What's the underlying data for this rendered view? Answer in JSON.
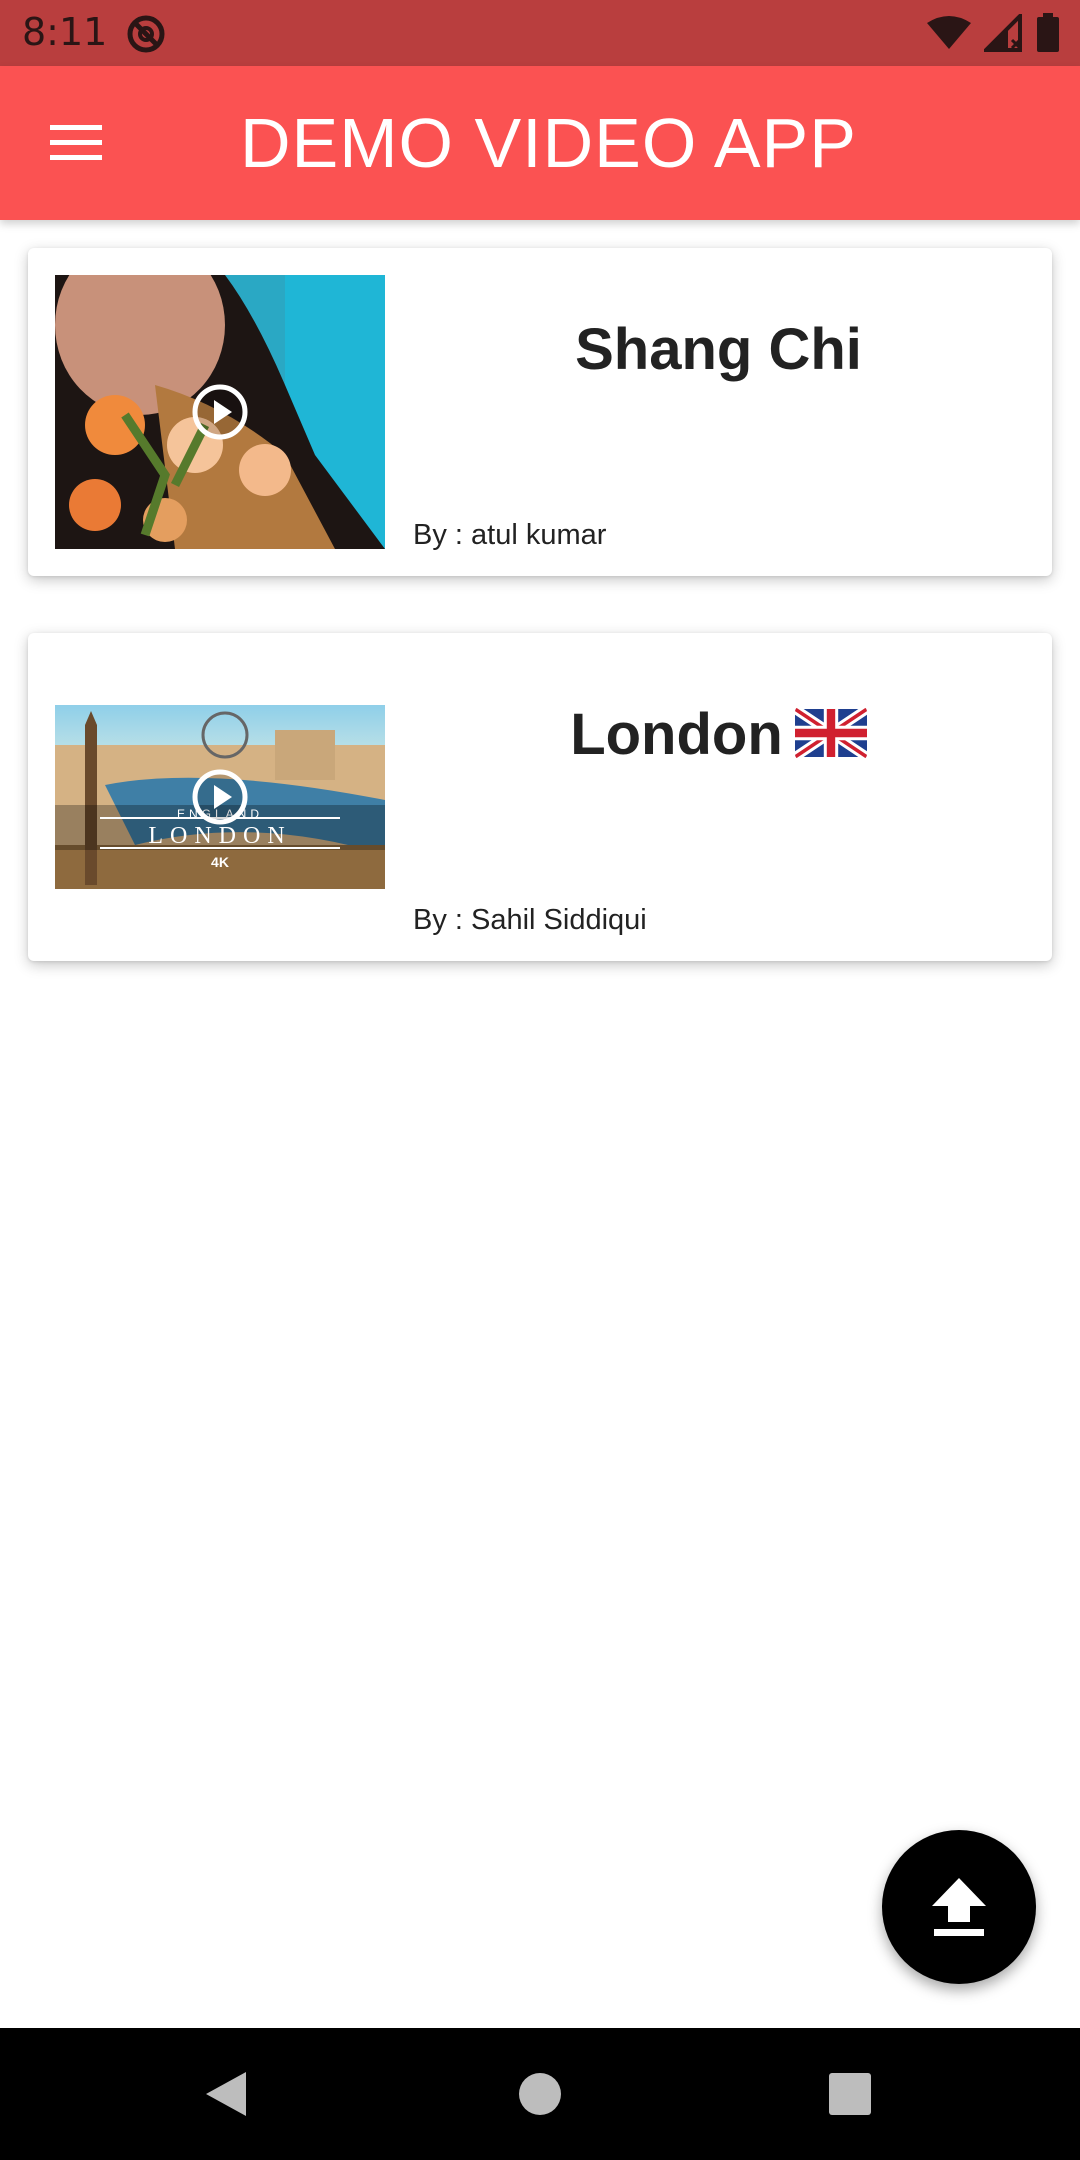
{
  "status_bar": {
    "time": "8:11",
    "icons": [
      "do-not-disturb-icon",
      "wifi-icon",
      "cellular-signal-icon",
      "battery-icon"
    ]
  },
  "app_bar": {
    "title": "DEMO VIDEO APP",
    "menu_icon": "hamburger-menu-icon",
    "color": "#fb5252"
  },
  "videos": [
    {
      "title": "Shang Chi",
      "author": "By : atul kumar",
      "thumbnail_icon": "play-icon"
    },
    {
      "title": "London",
      "title_emoji": "uk-flag-icon",
      "author": "By : Sahil Siddiqui",
      "thumbnail_icon": "play-icon",
      "thumbnail_text": {
        "top": "ENGLAND",
        "main": "LONDON",
        "badge": "4K"
      }
    }
  ],
  "fab": {
    "icon": "upload-icon",
    "color": "#000000"
  },
  "nav_bar": {
    "buttons": [
      "back-icon",
      "home-icon",
      "recents-icon"
    ]
  }
}
